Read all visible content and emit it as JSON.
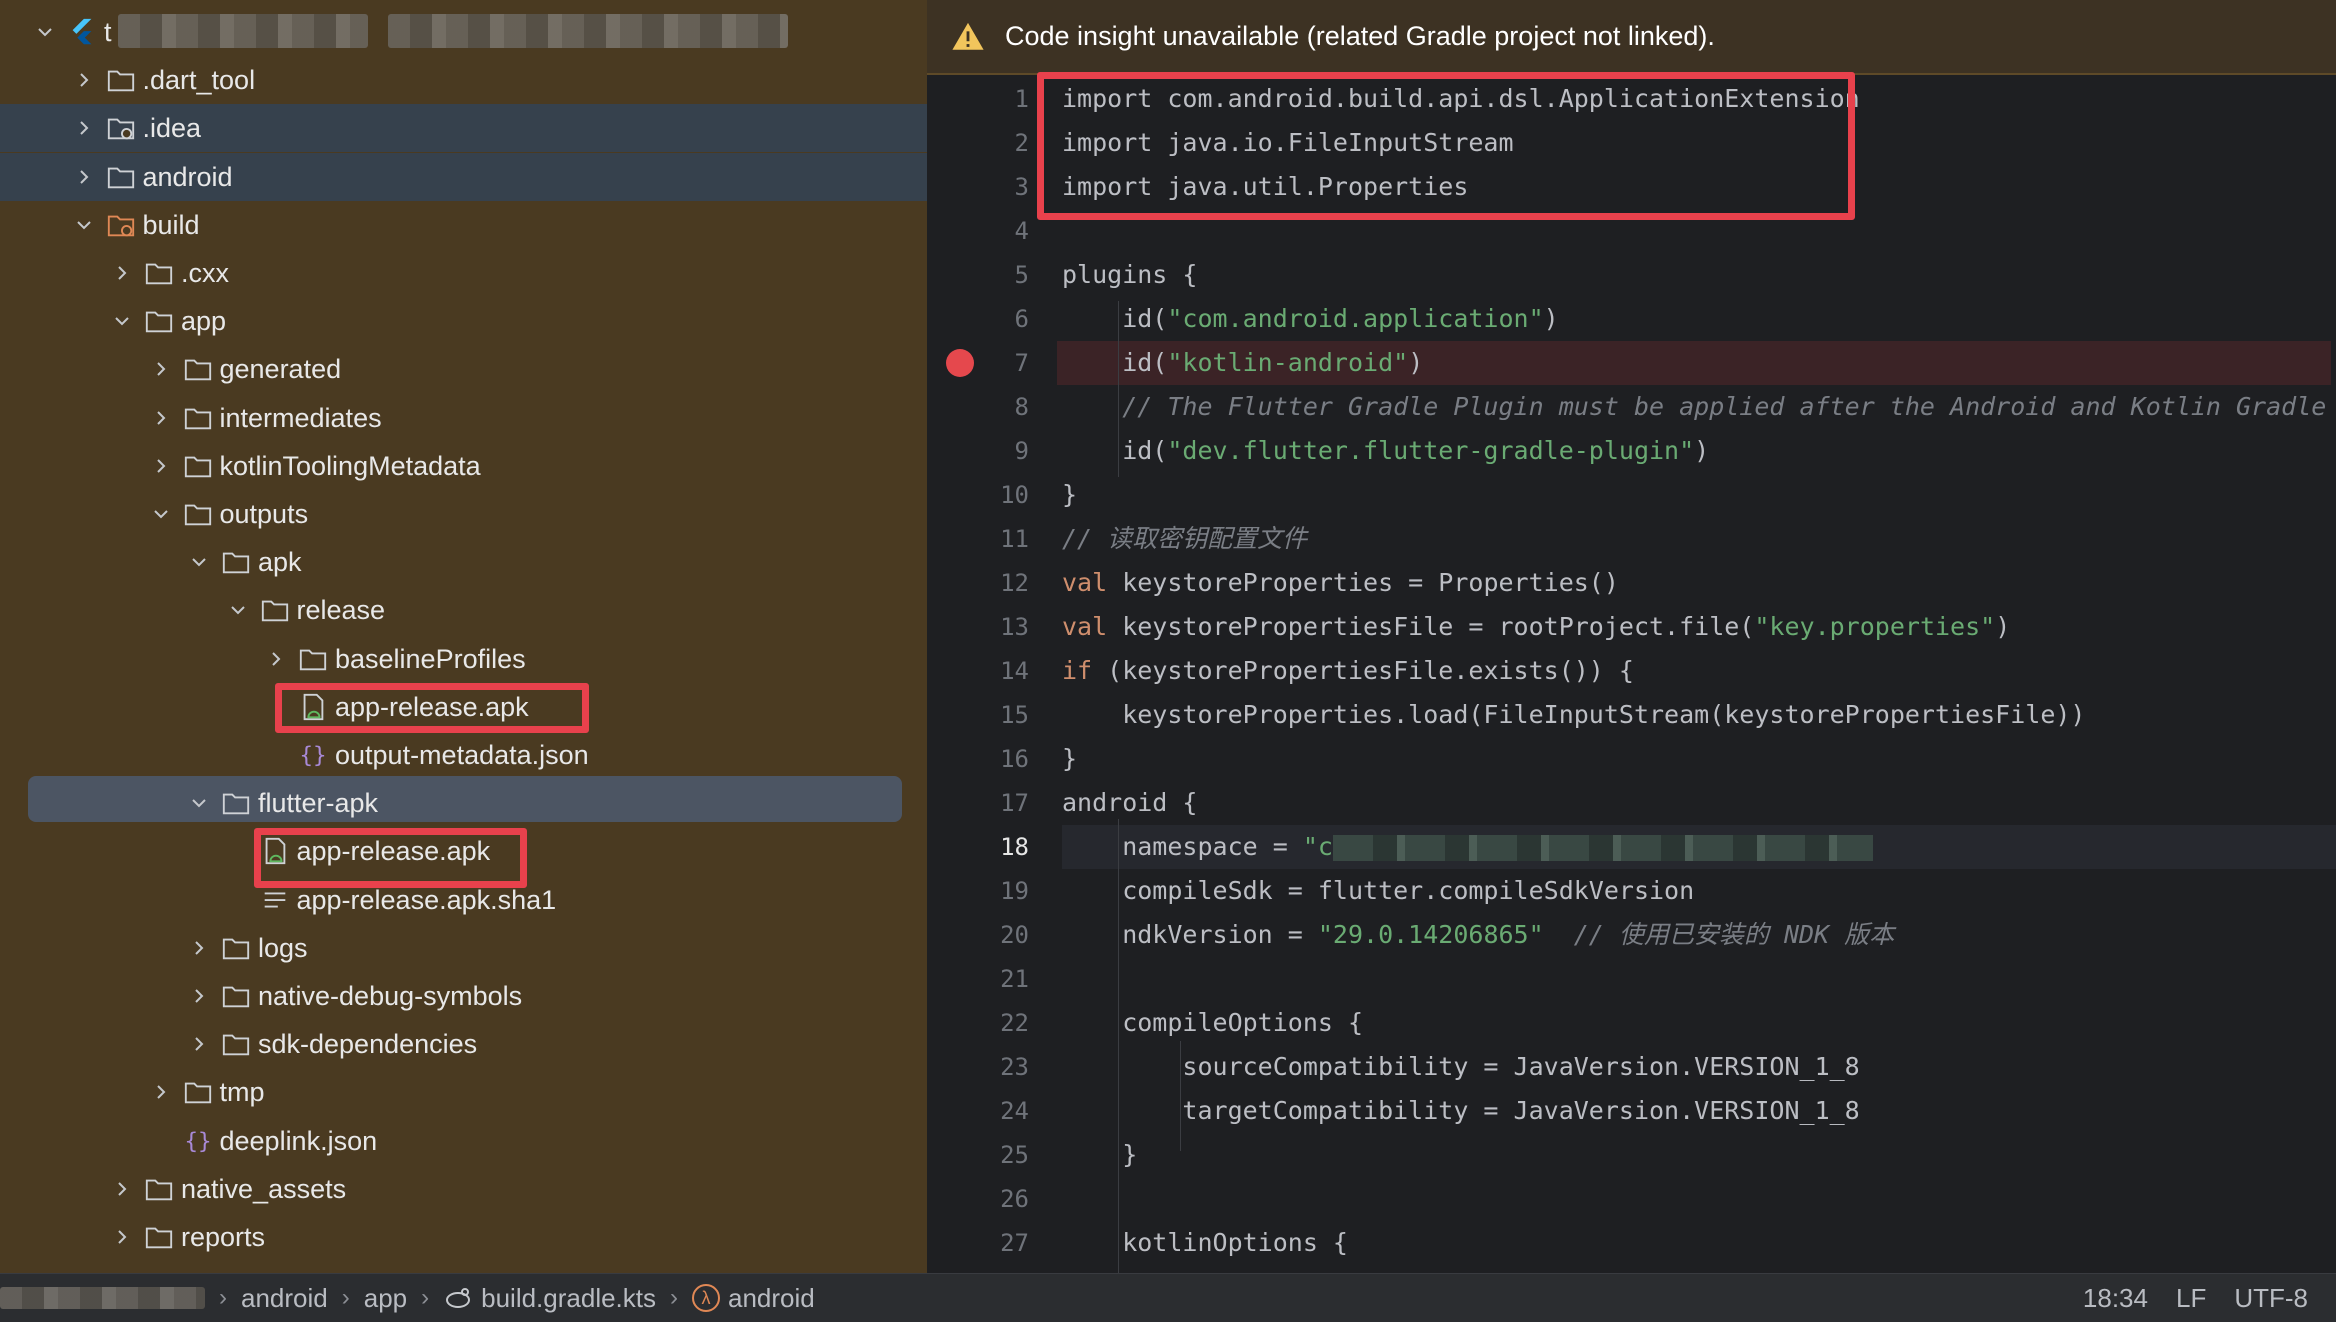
{
  "tree": {
    "rows": [
      {
        "label": "t",
        "icon": "flutter-icon",
        "depth": 0,
        "expanded": true
      },
      {
        "label": ".dart_tool",
        "icon": "folder-icon",
        "depth": 1,
        "expanded": false
      },
      {
        "label": ".idea",
        "icon": "folder-settings-icon",
        "depth": 1,
        "expanded": false
      },
      {
        "label": "android",
        "icon": "folder-icon",
        "depth": 1,
        "expanded": false
      },
      {
        "label": "build",
        "icon": "folder-excluded-icon",
        "depth": 1,
        "expanded": true
      },
      {
        "label": ".cxx",
        "icon": "folder-icon",
        "depth": 2,
        "expanded": false
      },
      {
        "label": "app",
        "icon": "folder-icon",
        "depth": 2,
        "expanded": true
      },
      {
        "label": "generated",
        "icon": "folder-icon",
        "depth": 3,
        "expanded": false
      },
      {
        "label": "intermediates",
        "icon": "folder-icon",
        "depth": 3,
        "expanded": false
      },
      {
        "label": "kotlinToolingMetadata",
        "icon": "folder-icon",
        "depth": 3,
        "expanded": false
      },
      {
        "label": "outputs",
        "icon": "folder-icon",
        "depth": 3,
        "expanded": true
      },
      {
        "label": "apk",
        "icon": "folder-icon",
        "depth": 4,
        "expanded": true
      },
      {
        "label": "release",
        "icon": "folder-icon",
        "depth": 5,
        "expanded": true
      },
      {
        "label": "baselineProfiles",
        "icon": "folder-icon",
        "depth": 6,
        "expanded": false
      },
      {
        "label": "app-release.apk",
        "icon": "apk-icon",
        "depth": 6,
        "expanded": null
      },
      {
        "label": "output-metadata.json",
        "icon": "json-icon",
        "depth": 6,
        "expanded": null
      },
      {
        "label": "flutter-apk",
        "icon": "folder-icon",
        "depth": 4,
        "expanded": true
      },
      {
        "label": "app-release.apk",
        "icon": "apk-icon",
        "depth": 5,
        "expanded": null
      },
      {
        "label": "app-release.apk.sha1",
        "icon": "text-file-icon",
        "depth": 5,
        "expanded": null
      },
      {
        "label": "logs",
        "icon": "folder-icon",
        "depth": 4,
        "expanded": false
      },
      {
        "label": "native-debug-symbols",
        "icon": "folder-icon",
        "depth": 4,
        "expanded": false
      },
      {
        "label": "sdk-dependencies",
        "icon": "folder-icon",
        "depth": 4,
        "expanded": false
      },
      {
        "label": "tmp",
        "icon": "folder-icon",
        "depth": 3,
        "expanded": false
      },
      {
        "label": "deeplink.json",
        "icon": "json-icon",
        "depth": 3,
        "expanded": null
      },
      {
        "label": "native_assets",
        "icon": "folder-icon",
        "depth": 2,
        "expanded": false
      },
      {
        "label": "reports",
        "icon": "folder-icon",
        "depth": 2,
        "expanded": false
      }
    ]
  },
  "editor": {
    "banner": "Code insight unavailable (related Gradle project not linked).",
    "current_line": 18,
    "breakpoint_line": 7,
    "lines": [
      [
        [
          "plain",
          "import com.android.build.api.dsl.ApplicationExtension"
        ]
      ],
      [
        [
          "plain",
          "import java.io.FileInputStream"
        ]
      ],
      [
        [
          "plain",
          "import java.util.Properties"
        ]
      ],
      [],
      [
        [
          "plain",
          "plugins {"
        ]
      ],
      [
        [
          "plain",
          "    id("
        ],
        [
          "str",
          "\"com.android.application\""
        ],
        [
          "plain",
          ")"
        ]
      ],
      [
        [
          "plain",
          "    id("
        ],
        [
          "str",
          "\"kotlin-android\""
        ],
        [
          "plain",
          ")"
        ]
      ],
      [
        [
          "cmt",
          "    // The Flutter Gradle Plugin must be applied after the Android and Kotlin Gradle plugins."
        ]
      ],
      [
        [
          "plain",
          "    id("
        ],
        [
          "str",
          "\"dev.flutter.flutter-gradle-plugin\""
        ],
        [
          "plain",
          ")"
        ]
      ],
      [
        [
          "plain",
          "}"
        ]
      ],
      [
        [
          "cmt",
          "// 读取密钥配置文件"
        ]
      ],
      [
        [
          "kw",
          "val"
        ],
        [
          "plain",
          " keystoreProperties = Properties()"
        ]
      ],
      [
        [
          "kw",
          "val"
        ],
        [
          "plain",
          " keystorePropertiesFile = rootProject.file("
        ],
        [
          "str",
          "\"key.properties\""
        ],
        [
          "plain",
          ")"
        ]
      ],
      [
        [
          "kw",
          "if"
        ],
        [
          "plain",
          " (keystorePropertiesFile.exists()) {"
        ]
      ],
      [
        [
          "plain",
          "    keystoreProperties.load(FileInputStream(keystorePropertiesFile))"
        ]
      ],
      [
        [
          "plain",
          "}"
        ]
      ],
      [
        [
          "plain",
          "android {"
        ]
      ],
      [
        [
          "plain",
          "    namespace = "
        ],
        [
          "str",
          "\"c"
        ],
        [
          "blur",
          ""
        ]
      ],
      [
        [
          "plain",
          "    compileSdk = flutter.compileSdkVersion"
        ]
      ],
      [
        [
          "plain",
          "    ndkVersion = "
        ],
        [
          "str",
          "\"29.0.14206865\""
        ],
        [
          "cmt",
          "  // 使用已安装的 NDK 版本"
        ]
      ],
      [],
      [
        [
          "plain",
          "    compileOptions {"
        ]
      ],
      [
        [
          "plain",
          "        sourceCompatibility = JavaVersion.VERSION_1_8"
        ]
      ],
      [
        [
          "plain",
          "        targetCompatibility = JavaVersion.VERSION_1_8"
        ]
      ],
      [
        [
          "plain",
          "    }"
        ]
      ],
      [],
      [
        [
          "plain",
          "    kotlinOptions {"
        ]
      ]
    ]
  },
  "status": {
    "crumbs": [
      {
        "label": "android",
        "icon": null
      },
      {
        "label": "app",
        "icon": null
      },
      {
        "label": "build.gradle.kts",
        "icon": "gradle-icon"
      },
      {
        "label": "android",
        "icon": "lambda-icon"
      }
    ],
    "position": "18:34",
    "line_ending": "LF",
    "encoding": "UTF-8"
  },
  "colors": {
    "tree_bg": "#4a3a21",
    "accent_red": "#e8414c",
    "string_green": "#6aab73",
    "keyword_orange": "#cf8e6d"
  }
}
